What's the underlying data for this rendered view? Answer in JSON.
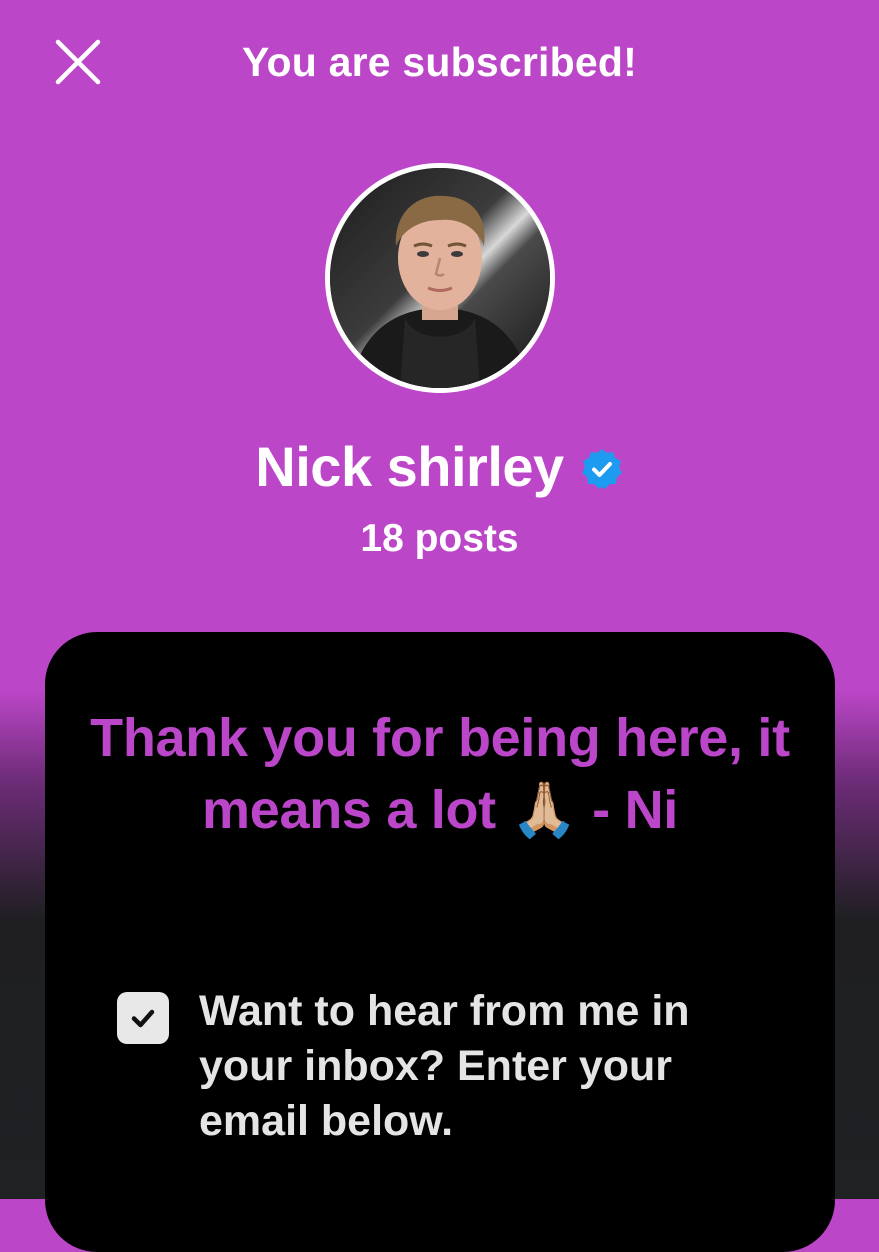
{
  "header": {
    "title": "You are subscribed!",
    "close_icon": "close-icon"
  },
  "profile": {
    "avatar_icon": "avatar-photo",
    "name": "Nick shirley",
    "verified_icon": "verified-badge-icon",
    "post_count": "18 posts"
  },
  "card": {
    "message": "Thank you for being here, it means a lot 🙏🏼 - Ni",
    "email_optin": {
      "checked": true,
      "checkbox_icon": "checkmark-icon",
      "label": "Want to hear from me in your inbox? Enter your email below."
    }
  },
  "colors": {
    "background_top": "#bc46c8",
    "background_bottom": "#1f2123",
    "card_background": "#000000",
    "accent_text": "#bb46c9",
    "verified_blue": "#1d9bf0"
  }
}
